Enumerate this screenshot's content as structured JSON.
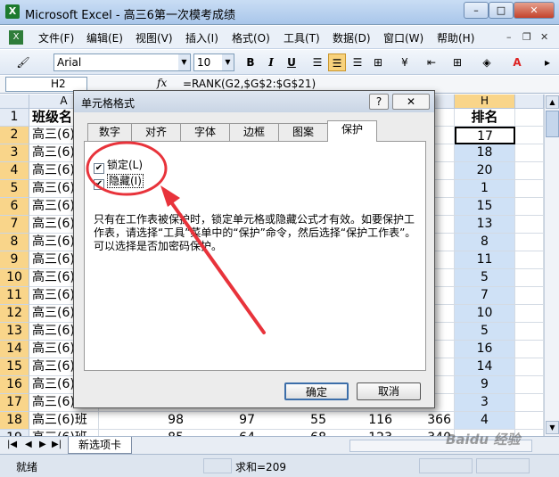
{
  "window": {
    "title": "Microsoft Excel - 高三6第一次模考成绩",
    "app_icon": "X",
    "min_label": "–",
    "max_label": "□",
    "close_label": "✕"
  },
  "menu": {
    "items": [
      "文件(F)",
      "编辑(E)",
      "视图(V)",
      "插入(I)",
      "格式(O)",
      "工具(T)",
      "数据(D)",
      "窗口(W)",
      "帮助(H)"
    ],
    "doc_min": "–",
    "doc_restore": "❐",
    "doc_close": "✕"
  },
  "toolbar": {
    "font_name": "Arial",
    "font_size": "10",
    "bold": "B",
    "italic": "I",
    "underline": "U"
  },
  "formula_bar": {
    "cell_ref": "H2",
    "fx": "fx",
    "formula": "=RANK(G2,$G$2:$G$21)"
  },
  "grid": {
    "columns": [
      "A",
      "H"
    ],
    "row_numbers": [
      "1",
      "2",
      "3",
      "4",
      "5",
      "6",
      "7",
      "8",
      "9",
      "10",
      "11",
      "12",
      "13",
      "14",
      "15",
      "16",
      "17",
      "18",
      "19"
    ],
    "header_a": "班级名",
    "header_h": "排名",
    "class_cells": [
      "高三(6)",
      "高三(6)",
      "高三(6)",
      "高三(6)",
      "高三(6)",
      "高三(6)",
      "高三(6)",
      "高三(6)",
      "高三(6)",
      "高三(6)",
      "高三(6)",
      "高三(6)",
      "高三(6)",
      "高三(6)",
      "高三(6)",
      "高三(6)",
      "高三(6)班",
      "高三(6)班"
    ],
    "ranks": [
      "17",
      "18",
      "20",
      "1",
      "15",
      "13",
      "8",
      "11",
      "5",
      "7",
      "10",
      "5",
      "16",
      "14",
      "9",
      "3",
      "4"
    ],
    "row18_scores": [
      "98",
      "97",
      "55",
      "116",
      "366"
    ],
    "row19_scores": [
      "85",
      "64",
      "68",
      "123",
      "340"
    ]
  },
  "sheet_tabs": {
    "nav": [
      "|◀",
      "◀",
      "▶",
      "▶|"
    ],
    "active_tab": "新选项卡"
  },
  "status": {
    "ready": "就绪",
    "sum": "求和=209"
  },
  "dialog": {
    "title": "单元格格式",
    "help": "?",
    "close": "✕",
    "tabs": [
      "数字",
      "对齐",
      "字体",
      "边框",
      "图案",
      "保护"
    ],
    "active_tab": "保护",
    "locked_label": "锁定(L)",
    "locked_checked": true,
    "hidden_label": "隐藏(I)",
    "hidden_checked": true,
    "check_mark": "✔",
    "description": "只有在工作表被保护时，锁定单元格或隐藏公式才有效。如要保护工作表，请选择“工具”菜单中的“保护”命令，然后选择“保护工作表”。可以选择是否加密码保护。",
    "ok": "确定",
    "cancel": "取消"
  },
  "watermark": "Baidu 经验",
  "colors": {
    "annotation_red": "#e8333b",
    "rank_fill": "#cfe1f6",
    "selection_header": "#f9d58a"
  }
}
